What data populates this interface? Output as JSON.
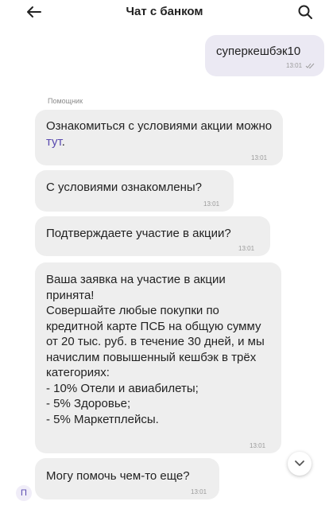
{
  "header": {
    "title": "Чат с банком"
  },
  "chat": {
    "sender_label": "Помощник",
    "messages": [
      {
        "text": "суперкешбэк10",
        "time": "13:01"
      },
      {
        "text_before_link": "Ознакомиться с условиями акции можно ",
        "link_text": "тут",
        "text_after_link": ".",
        "time": "13:01"
      },
      {
        "text": "С условиями ознакомлены?",
        "time": "13:01"
      },
      {
        "text": "Подтверждаете участие в акции?",
        "time": "13:01"
      },
      {
        "text": "Ваша заявка на участие в акции принята!\nСовершайте любые покупки по кредитной карте ПСБ на общую сумму от 20 тыс. руб. в течение 30 дней, и мы начислим повышенный кешбэк в трёх категориях:\n- 10% Отели и авиабилеты;\n- 5% Здоровье;\n- 5% Маркетплейсы.",
        "time": "13:01"
      },
      {
        "text": "Могу помочь чем-то еще?",
        "time": "13:01"
      }
    ],
    "avatar_letter": "П"
  },
  "icons": {
    "back": "arrow-left-icon",
    "search": "search-icon",
    "read": "double-check-icon",
    "scroll_down": "chevron-down-icon"
  },
  "colors": {
    "accent": "#5a4bb0",
    "bubble_out": "#ebe9f3",
    "bubble_in": "#eeeeee"
  }
}
